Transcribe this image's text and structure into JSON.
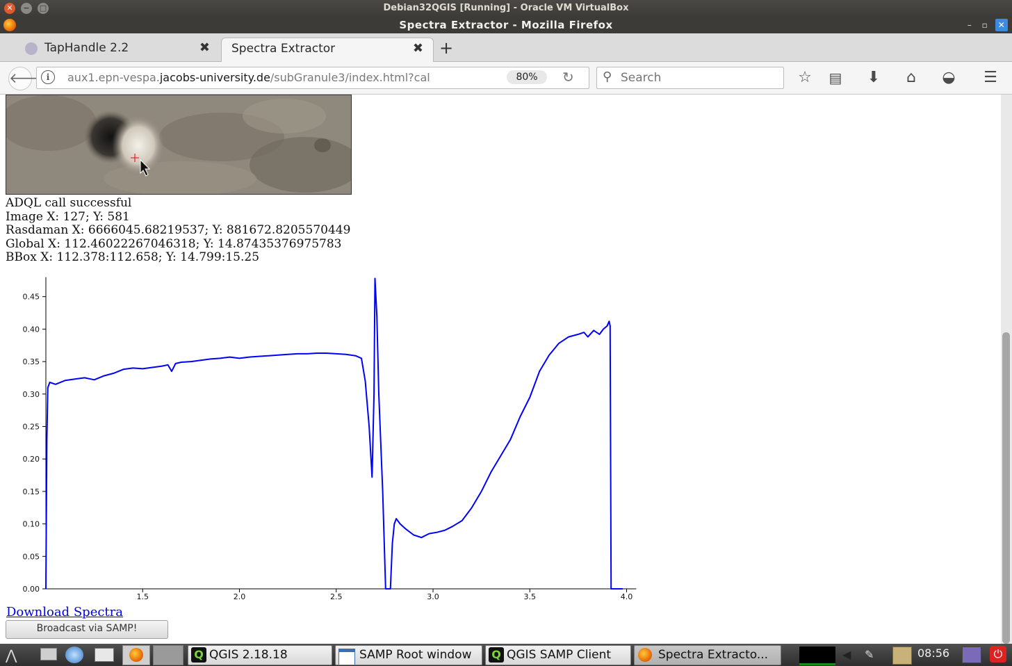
{
  "vbox": {
    "title": "Debian32QGIS [Running] - Oracle VM VirtualBox"
  },
  "firefox": {
    "window_title": "Spectra Extractor - Mozilla Firefox"
  },
  "tabs": [
    {
      "label": "TapHandle 2.2",
      "active": false
    },
    {
      "label": "Spectra Extractor",
      "active": true
    }
  ],
  "nav": {
    "url_pre": "aux1.epn-vespa.",
    "url_domain": "jacobs-university.de",
    "url_post": "/subGranule3/index.html?cal",
    "zoom": "80%",
    "search_placeholder": "Search"
  },
  "page": {
    "status": "ADQL call successful",
    "image_xy": "Image X: 127; Y: 581",
    "rasdaman_xy": "Rasdaman X: 6666045.68219537; Y: 881672.8205570449",
    "global_xy": "Global X: 112.46022267046318; Y: 14.87435376975783",
    "bbox": "BBox X: 112.378:112.658; Y: 14.799:15.25",
    "download_label": "Download Spectra",
    "samp_label": "Broadcast via SAMP!"
  },
  "chart_data": {
    "type": "line",
    "title": "",
    "xlabel": "",
    "ylabel": "",
    "xlim": [
      1.0,
      4.05
    ],
    "ylim": [
      0.0,
      0.48
    ],
    "x_ticks": [
      "1.5",
      "2.0",
      "2.5",
      "3.0",
      "3.5",
      "4.0"
    ],
    "y_ticks": [
      "0.00",
      "0.05",
      "0.10",
      "0.15",
      "0.20",
      "0.25",
      "0.30",
      "0.35",
      "0.40",
      "0.45"
    ],
    "series": [
      {
        "color": "#0000ff",
        "points": [
          [
            1.0,
            0.0
          ],
          [
            1.005,
            0.23
          ],
          [
            1.01,
            0.31
          ],
          [
            1.02,
            0.318
          ],
          [
            1.05,
            0.315
          ],
          [
            1.1,
            0.321
          ],
          [
            1.15,
            0.323
          ],
          [
            1.2,
            0.325
          ],
          [
            1.25,
            0.322
          ],
          [
            1.3,
            0.328
          ],
          [
            1.35,
            0.332
          ],
          [
            1.4,
            0.338
          ],
          [
            1.45,
            0.34
          ],
          [
            1.5,
            0.339
          ],
          [
            1.55,
            0.341
          ],
          [
            1.6,
            0.343
          ],
          [
            1.63,
            0.345
          ],
          [
            1.65,
            0.335
          ],
          [
            1.67,
            0.347
          ],
          [
            1.7,
            0.349
          ],
          [
            1.75,
            0.35
          ],
          [
            1.8,
            0.352
          ],
          [
            1.85,
            0.354
          ],
          [
            1.9,
            0.355
          ],
          [
            1.95,
            0.357
          ],
          [
            2.0,
            0.355
          ],
          [
            2.05,
            0.357
          ],
          [
            2.1,
            0.358
          ],
          [
            2.15,
            0.359
          ],
          [
            2.2,
            0.36
          ],
          [
            2.25,
            0.361
          ],
          [
            2.3,
            0.362
          ],
          [
            2.35,
            0.362
          ],
          [
            2.4,
            0.363
          ],
          [
            2.45,
            0.363
          ],
          [
            2.5,
            0.362
          ],
          [
            2.55,
            0.361
          ],
          [
            2.6,
            0.359
          ],
          [
            2.63,
            0.355
          ],
          [
            2.65,
            0.32
          ],
          [
            2.67,
            0.25
          ],
          [
            2.685,
            0.172
          ],
          [
            2.695,
            0.3
          ],
          [
            2.7,
            0.478
          ],
          [
            2.71,
            0.42
          ],
          [
            2.72,
            0.3
          ],
          [
            2.74,
            0.15
          ],
          [
            2.755,
            0.0
          ],
          [
            2.77,
            0.0
          ],
          [
            2.78,
            0.0
          ],
          [
            2.79,
            0.07
          ],
          [
            2.8,
            0.1
          ],
          [
            2.81,
            0.108
          ],
          [
            2.83,
            0.1
          ],
          [
            2.86,
            0.092
          ],
          [
            2.9,
            0.083
          ],
          [
            2.94,
            0.079
          ],
          [
            2.98,
            0.085
          ],
          [
            3.02,
            0.087
          ],
          [
            3.06,
            0.09
          ],
          [
            3.1,
            0.096
          ],
          [
            3.15,
            0.105
          ],
          [
            3.2,
            0.125
          ],
          [
            3.25,
            0.15
          ],
          [
            3.3,
            0.18
          ],
          [
            3.35,
            0.205
          ],
          [
            3.4,
            0.23
          ],
          [
            3.45,
            0.265
          ],
          [
            3.5,
            0.295
          ],
          [
            3.55,
            0.335
          ],
          [
            3.6,
            0.36
          ],
          [
            3.65,
            0.378
          ],
          [
            3.7,
            0.388
          ],
          [
            3.75,
            0.392
          ],
          [
            3.78,
            0.395
          ],
          [
            3.8,
            0.388
          ],
          [
            3.83,
            0.398
          ],
          [
            3.86,
            0.392
          ],
          [
            3.88,
            0.4
          ],
          [
            3.9,
            0.405
          ],
          [
            3.91,
            0.412
          ],
          [
            3.915,
            0.405
          ],
          [
            3.92,
            0.0
          ],
          [
            3.98,
            0.0
          ]
        ]
      }
    ]
  },
  "taskbar": {
    "items": [
      "QGIS 2.18.18",
      "SAMP Root window",
      "QGIS SAMP Client",
      "Spectra Extracto..."
    ],
    "clock": "08:56"
  }
}
